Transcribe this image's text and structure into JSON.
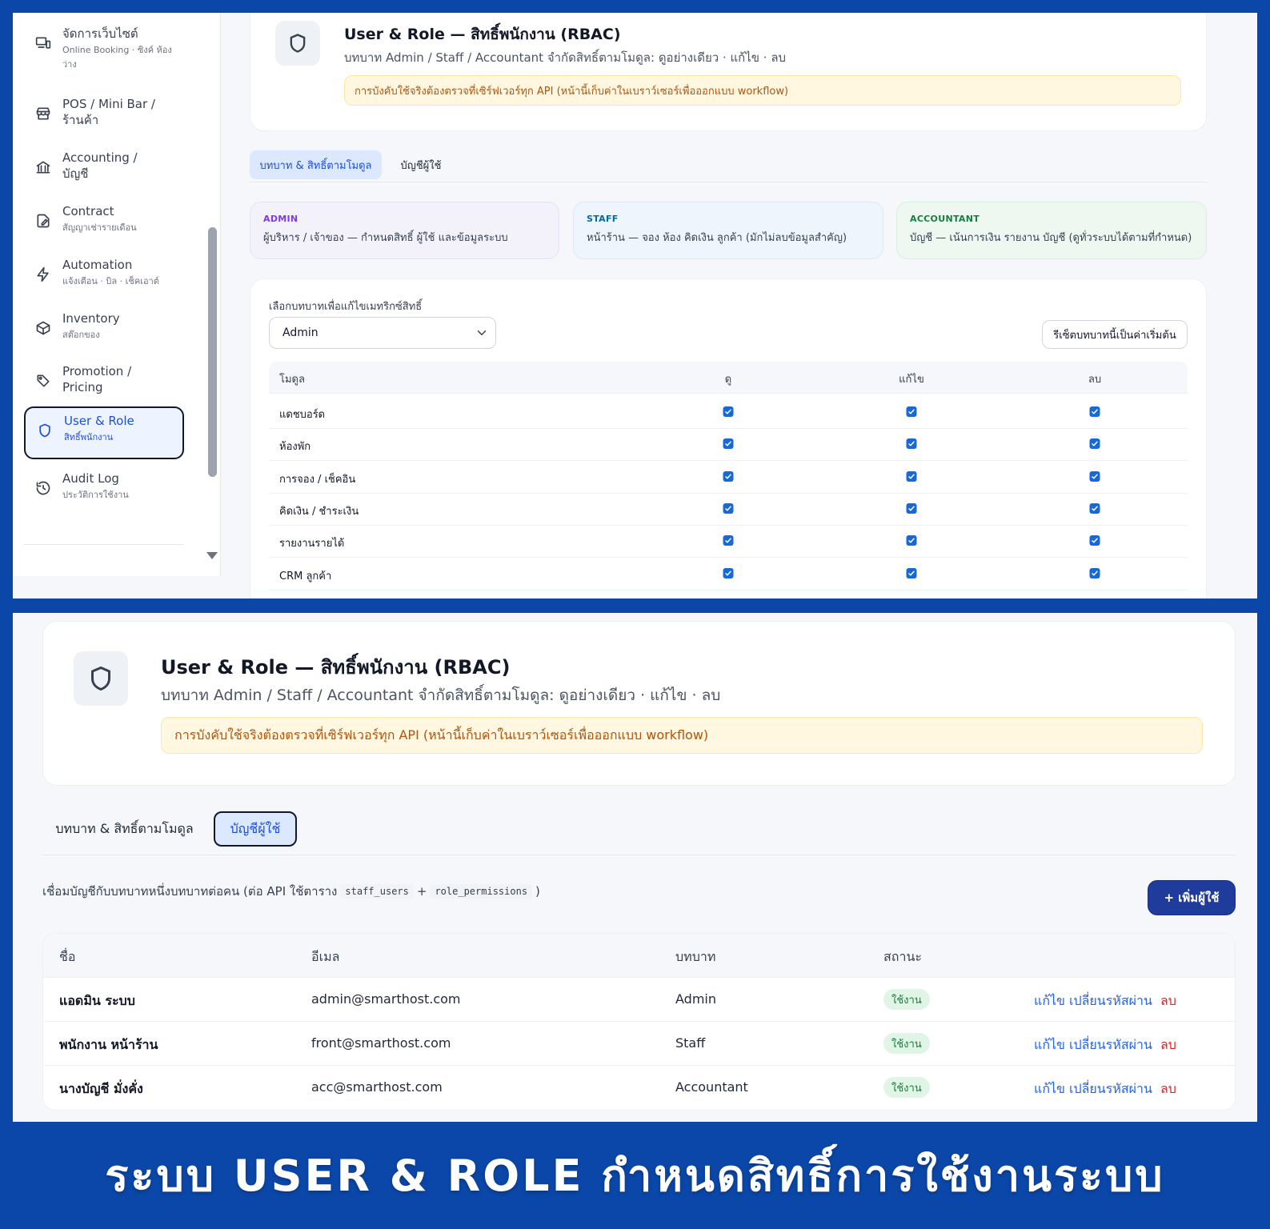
{
  "sidebar": {
    "items": [
      {
        "icon": "devices-icon",
        "label": "จัดการเว็บไซต์",
        "sub": "Online Booking · ซิงค์ ห้องว่าง"
      },
      {
        "icon": "store-icon",
        "label": "POS / Mini Bar / ร้านค้า",
        "sub": ""
      },
      {
        "icon": "bank-icon",
        "label": "Accounting / บัญชี",
        "sub": ""
      },
      {
        "icon": "contract-icon",
        "label": "Contract",
        "sub": "สัญญาเช่ารายเดือน"
      },
      {
        "icon": "bolt-icon",
        "label": "Automation",
        "sub": "แจ้งเตือน · บิล · เช็คเอาต์"
      },
      {
        "icon": "box-icon",
        "label": "Inventory",
        "sub": "สต๊อกของ"
      },
      {
        "icon": "tag-icon",
        "label": "Promotion / Pricing",
        "sub": ""
      },
      {
        "icon": "shield-icon",
        "label": "User & Role",
        "sub": "สิทธิ์พนักงาน",
        "active": true
      },
      {
        "icon": "history-icon",
        "label": "Audit Log",
        "sub": "ประวัติการใช้งาน"
      }
    ]
  },
  "header": {
    "title": "User & Role — สิทธิ์พนักงาน (RBAC)",
    "subtitle": "บทบาท Admin / Staff / Accountant จำกัดสิทธิ์ตามโมดูล: ดูอย่างเดียว · แก้ไข · ลบ",
    "warning": "การบังคับใช้จริงต้องตรวจที่เซิร์ฟเวอร์ทุก API (หน้านี้เก็บค่าในเบราว์เซอร์เพื่อออกแบบ workflow)"
  },
  "tabs": {
    "roles": "บทบาท & สิทธิ์ตามโมดูล",
    "accounts": "บัญชีผู้ใช้"
  },
  "roles": [
    {
      "name": "ADMIN",
      "desc": "ผู้บริหาร / เจ้าของ — กำหนดสิทธิ์ ผู้ใช้ และข้อมูลระบบ",
      "color": "#7c3aed",
      "bg": "#f3f2fb",
      "border": "#e6e3f5"
    },
    {
      "name": "STAFF",
      "desc": "หน้าร้าน — จอง ห้อง คิดเงิน ลูกค้า (มักไม่ลบข้อมูลสำคัญ)",
      "color": "#0369a1",
      "bg": "#eef5fc",
      "border": "#dde9f7"
    },
    {
      "name": "ACCOUNTANT",
      "desc": "บัญชี — เน้นการเงิน รายงาน บัญชี (ดูทั่วระบบได้ตามที่กำหนด)",
      "color": "#15803d",
      "bg": "#eef8f1",
      "border": "#d9efe0"
    }
  ],
  "matrix": {
    "select_label": "เลือกบทบาทเพื่อแก้ไขเมทริกซ์สิทธิ์",
    "selected_role": "Admin",
    "reset_label": "รีเซ็ตบทบาทนี้เป็นค่าเริ่มต้น",
    "columns": {
      "module": "โมดูล",
      "view": "ดู",
      "edit": "แก้ไข",
      "delete": "ลบ"
    },
    "rows": [
      {
        "module": "แดชบอร์ด",
        "view": true,
        "edit": true,
        "delete": true
      },
      {
        "module": "ห้องพัก",
        "view": true,
        "edit": true,
        "delete": true
      },
      {
        "module": "การจอง / เช็คอิน",
        "view": true,
        "edit": true,
        "delete": true
      },
      {
        "module": "คิดเงิน / ชำระเงิน",
        "view": true,
        "edit": true,
        "delete": true
      },
      {
        "module": "รายงานรายได้",
        "view": true,
        "edit": true,
        "delete": true
      },
      {
        "module": "CRM ลูกค้า",
        "view": true,
        "edit": true,
        "delete": true
      }
    ]
  },
  "accounts": {
    "description": "เชื่อมบัญชีกับบทบาทหนึ่งบทบาทต่อคน (ต่อ API ใช้ตาราง",
    "code1": "staff_users",
    "plus": "+",
    "code2": "role_permissions",
    "close": ")",
    "add_button": "+ เพิ่มผู้ใช้",
    "columns": {
      "name": "ชื่อ",
      "email": "อีเมล",
      "role": "บทบาท",
      "status": "สถานะ"
    },
    "rows": [
      {
        "name": "แอดมิน ระบบ",
        "email": "admin@smarthost.com",
        "role": "Admin",
        "status": "ใช้งาน"
      },
      {
        "name": "พนักงาน หน้าร้าน",
        "email": "front@smarthost.com",
        "role": "Staff",
        "status": "ใช้งาน"
      },
      {
        "name": "นางบัญชี มั่งคั่ง",
        "email": "acc@smarthost.com",
        "role": "Accountant",
        "status": "ใช้งาน"
      }
    ],
    "actions": {
      "edit": "แก้ไข",
      "change_password": "เปลี่ยนรหัสผ่าน",
      "delete": "ลบ"
    }
  },
  "footer": {
    "caption": "ระบบ USER & ROLE กำหนดสิทธิ์การใช้งานระบบ"
  },
  "colors": {
    "frame": "#0b47a8",
    "accent": "#1d4ed8",
    "primary_button": "#1f3b9c",
    "danger": "#dc2626",
    "warning_text": "#b45309",
    "success": "#15803d"
  }
}
